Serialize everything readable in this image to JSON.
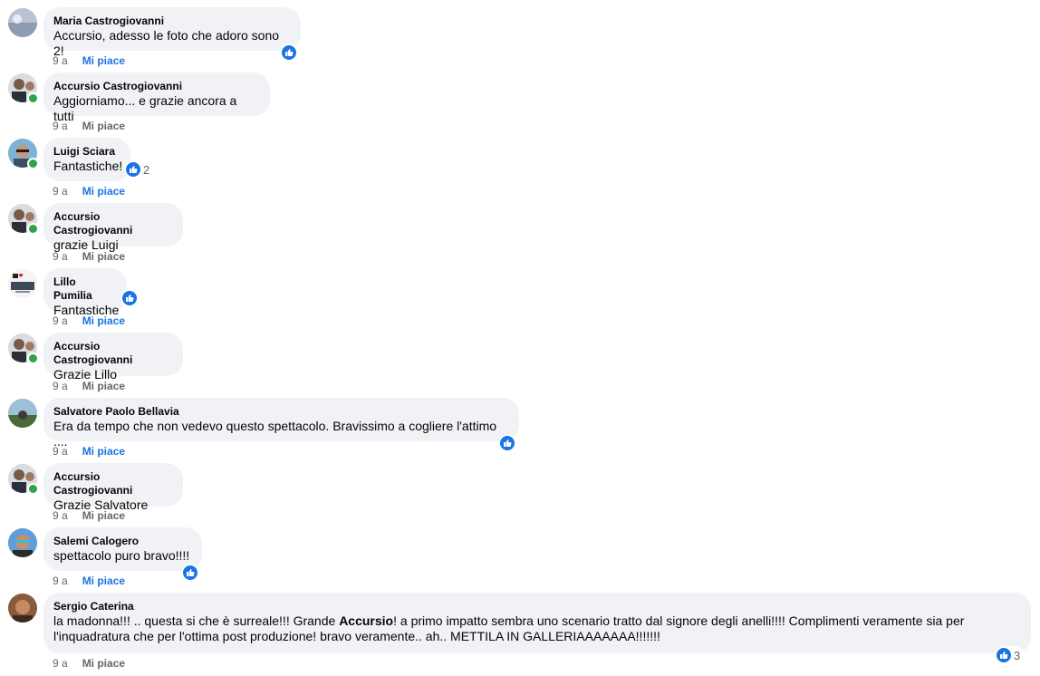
{
  "comments": [
    {
      "author": "Maria Castrogiovanni",
      "text": "Accursio, adesso le foto che adoro sono 2!",
      "time": "9 a",
      "like_label": "Mi piace",
      "reaction_count": "",
      "online": false
    },
    {
      "author": "Accursio Castrogiovanni",
      "text": "Aggiorniamo... e grazie ancora a tutti",
      "time": "9 a",
      "like_label": "Mi piace",
      "reaction_count": "",
      "online": true
    },
    {
      "author": "Luigi Sciara",
      "text": "Fantastiche!",
      "time": "9 a",
      "like_label": "Mi piace",
      "reaction_count": "2",
      "online": true
    },
    {
      "author": "Accursio Castrogiovanni",
      "text": "grazie Luigi",
      "time": "9 a",
      "like_label": "Mi piace",
      "reaction_count": "",
      "online": true
    },
    {
      "author": "Lillo Pumilia",
      "text": "Fantastiche",
      "time": "9 a",
      "like_label": "Mi piace",
      "reaction_count": "",
      "online": false
    },
    {
      "author": "Accursio Castrogiovanni",
      "text": "Grazie Lillo",
      "time": "9 a",
      "like_label": "Mi piace",
      "reaction_count": "",
      "online": true
    },
    {
      "author": "Salvatore Paolo Bellavia",
      "text": "Era da tempo che non vedevo questo spettacolo. Bravissimo a cogliere l'attimo ....",
      "time": "9 a",
      "like_label": "Mi piace",
      "reaction_count": "",
      "online": false
    },
    {
      "author": "Accursio Castrogiovanni",
      "text": "Grazie Salvatore",
      "time": "9 a",
      "like_label": "Mi piace",
      "reaction_count": "",
      "online": true
    },
    {
      "author": "Salemi Calogero",
      "text": "spettacolo puro bravo!!!!",
      "time": "9 a",
      "like_label": "Mi piace",
      "reaction_count": "",
      "online": false
    },
    {
      "author": "Sergio Caterina",
      "text_before": "la madonna!!! .. questa si che è surreale!!! Grande ",
      "text_mention": "Accursio",
      "text_after": "! a primo impatto sembra uno scenario tratto dal signore degli anelli!!!! Complimenti veramente sia per l'inquadratura che per l'ottima post produzione! bravo veramente.. ah.. METTILA IN GALLERIAAAAAAA!!!!!!!",
      "time": "9 a",
      "like_label": "Mi piace",
      "reaction_count": "3",
      "online": false
    }
  ],
  "colors": {
    "like_blue": "#1b74e4",
    "bubble_bg": "#f0f2f5",
    "meta_grey": "#65676b",
    "online_green": "#31a24c"
  }
}
